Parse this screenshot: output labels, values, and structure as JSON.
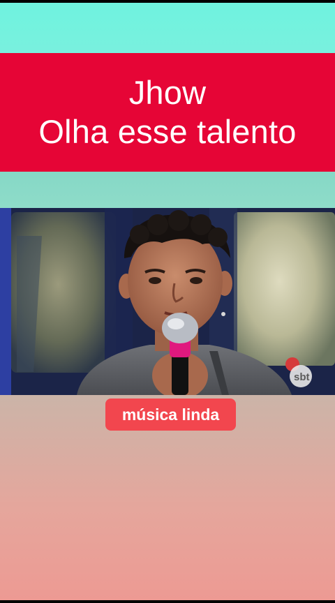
{
  "banner": {
    "line1": "Jhow",
    "line2": "Olha esse talento"
  },
  "video": {
    "watermark": "sbt"
  },
  "caption": {
    "text": "música linda"
  },
  "colors": {
    "top_teal": "#6ff3df",
    "banner_red": "#e60536",
    "mid_teal": "#8edcc9",
    "caption_red": "#f2464e",
    "bottom_gradient_start": "#cbb4a8",
    "bottom_gradient_end": "#ed9a93"
  }
}
